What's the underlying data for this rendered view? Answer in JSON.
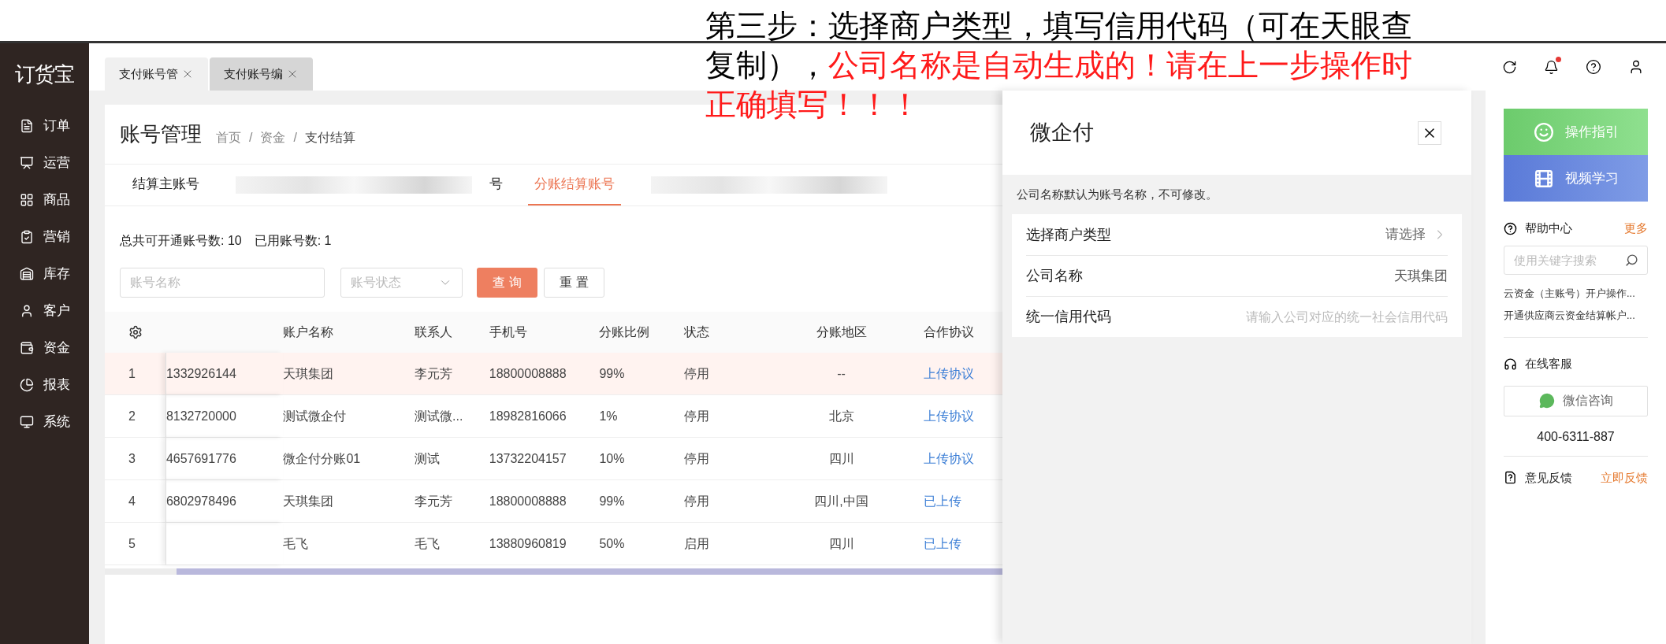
{
  "annotation": {
    "parts": [
      {
        "text": "第三步：选择商户类型，填写信用代码（可在天眼查复制），",
        "emphasis": false
      },
      {
        "text": "公司名称是自动生成的！请在上一步操作时正确填写！！！",
        "emphasis": true
      }
    ]
  },
  "sidebar": {
    "logo": "订货宝",
    "items": [
      {
        "label": "订单"
      },
      {
        "label": "运营"
      },
      {
        "label": "商品"
      },
      {
        "label": "营销"
      },
      {
        "label": "库存"
      },
      {
        "label": "客户"
      },
      {
        "label": "资金"
      },
      {
        "label": "报表"
      },
      {
        "label": "系统"
      }
    ]
  },
  "page_tabs": [
    {
      "label": "支付账号管",
      "selected": true
    },
    {
      "label": "支付账号编",
      "selected": false
    }
  ],
  "page": {
    "title": "账号管理",
    "breadcrumb": [
      {
        "kind": "link",
        "text": "首页"
      },
      {
        "kind": "separator",
        "text": "/"
      },
      {
        "kind": "link",
        "text": "资金"
      },
      {
        "kind": "separator",
        "text": "/"
      },
      {
        "kind": "current",
        "text": "支付结算"
      }
    ]
  },
  "account_tabs": [
    {
      "kind": "text",
      "label": "结算主账号",
      "selected": false
    },
    {
      "kind": "redacted"
    },
    {
      "kind": "text",
      "label": "号",
      "selected": false
    },
    {
      "kind": "text",
      "label": "分账结算账号",
      "selected": true
    },
    {
      "kind": "redacted"
    }
  ],
  "summary": {
    "total_label": "总共可开通账号数:",
    "total": "10",
    "used_label": "已用账号数:",
    "used": "1"
  },
  "filters": {
    "name_placeholder": "账号名称",
    "status_placeholder": "账号状态",
    "search_button": "查 询",
    "reset_button": "重 置"
  },
  "table": {
    "columns": [
      "账户名称",
      "联系人",
      "手机号",
      "分账比例",
      "状态",
      "分账地区",
      "合作协议"
    ],
    "rows": [
      {
        "index": "1",
        "column_2": "1332926144",
        "name": "天琪集团",
        "contact": "李元芳",
        "phone": "18800008888",
        "ratio": "99%",
        "status": "停用",
        "region": "--",
        "agreement": "上传协议",
        "highlighted": true
      },
      {
        "index": "2",
        "column_2": "8132720000",
        "name": "测试微企付",
        "contact": "测试微...",
        "phone": "18982816066",
        "ratio": "1%",
        "status": "停用",
        "region": "北京",
        "agreement": "上传协议",
        "highlighted": false
      },
      {
        "index": "3",
        "column_2": "4657691776",
        "name": "微企付分账01",
        "contact": "测试",
        "phone": "13732204157",
        "ratio": "10%",
        "status": "停用",
        "region": "四川",
        "agreement": "上传协议",
        "highlighted": false
      },
      {
        "index": "4",
        "column_2": "6802978496",
        "name": "天琪集团",
        "contact": "李元芳",
        "phone": "18800008888",
        "ratio": "99%",
        "status": "停用",
        "region": "四川,中国",
        "agreement": "已上传",
        "highlighted": false
      },
      {
        "index": "5",
        "name": "毛飞",
        "contact": "毛飞",
        "phone": "13880960819",
        "ratio": "50%",
        "status": "启用",
        "region": "四川",
        "agreement": "已上传",
        "highlighted": false
      }
    ]
  },
  "drawer": {
    "title": "微企付",
    "notice": "公司名称默认为账号名称，不可修改。",
    "fields": [
      {
        "kind": "select",
        "label": "选择商户类型",
        "placeholder": "请选择"
      },
      {
        "kind": "readonly",
        "label": "公司名称",
        "value": "天琪集团"
      },
      {
        "kind": "input",
        "label": "统一信用代码",
        "placeholder": "请输入公司对应的统一社会信用代码"
      }
    ]
  },
  "help_panel": {
    "guide_button": "操作指引",
    "video_button": "视频学习",
    "help_title": "帮助中心",
    "more_link": "更多",
    "search_placeholder": "使用关键字搜索",
    "articles": [
      "云资金（主账号）开户操作...",
      "开通供应商云资金结算帐户..."
    ],
    "service_title": "在线客服",
    "wechat_button": "微信咨询",
    "phone": "400-6311-887",
    "feedback_title": "意见反馈",
    "feedback_link": "立即反馈"
  },
  "notifications": {
    "unread": true
  }
}
